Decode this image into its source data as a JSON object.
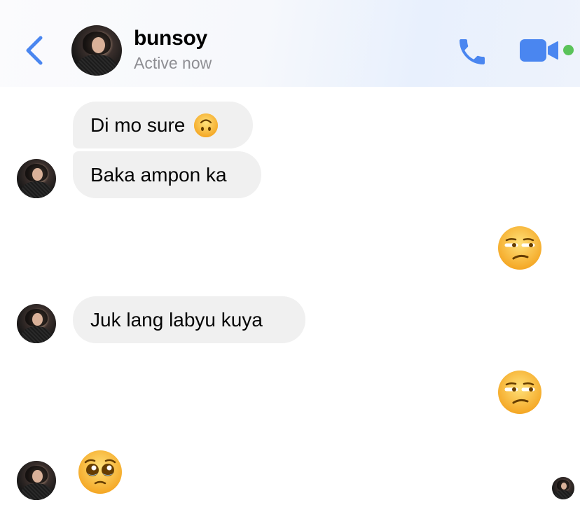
{
  "header": {
    "contact_name": "bunsoy",
    "status": "Active now",
    "back_icon": "chevron-left-icon",
    "call_icon": "phone-icon",
    "video_icon": "video-camera-icon",
    "online_indicator_color": "#5ac35a",
    "accent_color": "#4a86f0"
  },
  "messages": [
    {
      "sender": "contact",
      "type": "text",
      "text": "Di mo sure",
      "emoji": "🙃"
    },
    {
      "sender": "contact",
      "type": "text",
      "text": "Baka ampon ka"
    },
    {
      "sender": "me",
      "type": "emoji",
      "emoji": "😒"
    },
    {
      "sender": "contact",
      "type": "text",
      "text": "Juk lang labyu kuya"
    },
    {
      "sender": "me",
      "type": "emoji",
      "emoji": "😒"
    },
    {
      "sender": "contact",
      "type": "emoji",
      "emoji": "🥹"
    }
  ],
  "bubble_color": "#f0f0f0"
}
